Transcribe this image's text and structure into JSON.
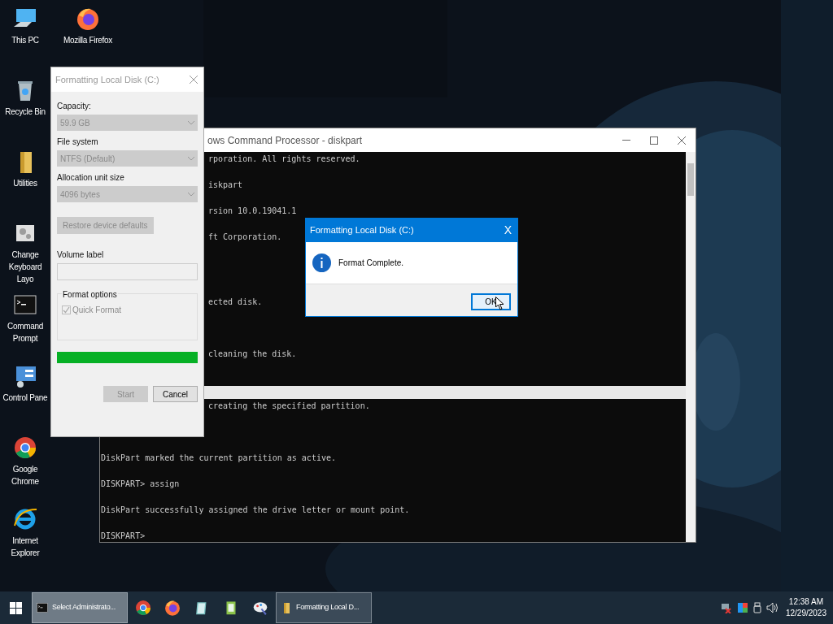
{
  "desktop_icons": [
    {
      "label": "This PC",
      "kind": "pc"
    },
    {
      "label": "Mozilla Firefox",
      "kind": "firefox"
    },
    {
      "label": "Recycle Bin",
      "kind": "bin"
    },
    {
      "label": "Utilities",
      "kind": "folder"
    },
    {
      "label": "Change Keyboard Layo",
      "kind": "keyboard"
    },
    {
      "label": "Command Prompt",
      "kind": "cmd"
    },
    {
      "label": "Control Pane",
      "kind": "control"
    },
    {
      "label": "Google Chrome",
      "kind": "chrome"
    },
    {
      "label": "Internet Explorer",
      "kind": "ie"
    }
  ],
  "cmd_window": {
    "title": "ows Command Processor - diskpart",
    "lines": [
      "rporation. All rights reserved.",
      "iskpart",
      "rsion 10.0.19041.1",
      "ft Corporation.",
      "ected disk.",
      "cleaning the disk.",
      "creating the specified partition.",
      "DiskPart marked the current partition as active.",
      "DISKPART> assign",
      "DiskPart successfully assigned the drive letter or mount point.",
      "DISKPART>"
    ]
  },
  "format_dialog": {
    "title": "Formatting Local Disk (C:)",
    "fields": [
      {
        "label": "Capacity:",
        "value": "59.9 GB",
        "disabled": true
      },
      {
        "label": "File system",
        "value": "NTFS (Default)",
        "disabled": true
      },
      {
        "label": "Allocation unit size",
        "value": "4096 bytes",
        "disabled": true
      }
    ],
    "restore_button": {
      "label": "Restore device defaults",
      "disabled": true
    },
    "volume_label": {
      "label": "Volume label",
      "disabled": true
    },
    "format_options": {
      "title": "Format options",
      "quick_format": {
        "label": "Quick Format",
        "checked": true,
        "disabled": true
      }
    },
    "progress": {
      "level": 1
    },
    "buttons": [
      {
        "label": "Start",
        "disabled": true
      },
      {
        "label": "Cancel",
        "disabled": false
      }
    ]
  },
  "message_box": {
    "title": "Formatting Local Disk (C:)",
    "close": "X",
    "message": "Format Complete.",
    "button": "OK"
  },
  "taskbar": {
    "items": [
      {
        "kind": "window",
        "label": "Select Administrato...",
        "selected": true
      },
      {
        "kind": "pin"
      },
      {
        "kind": "pin"
      },
      {
        "kind": "pin"
      },
      {
        "kind": "pin"
      },
      {
        "kind": "pin"
      },
      {
        "kind": "window",
        "label": "Formatting Local D...",
        "selected": false
      }
    ],
    "time": "12:38 AM",
    "date": "12/29/2023"
  }
}
